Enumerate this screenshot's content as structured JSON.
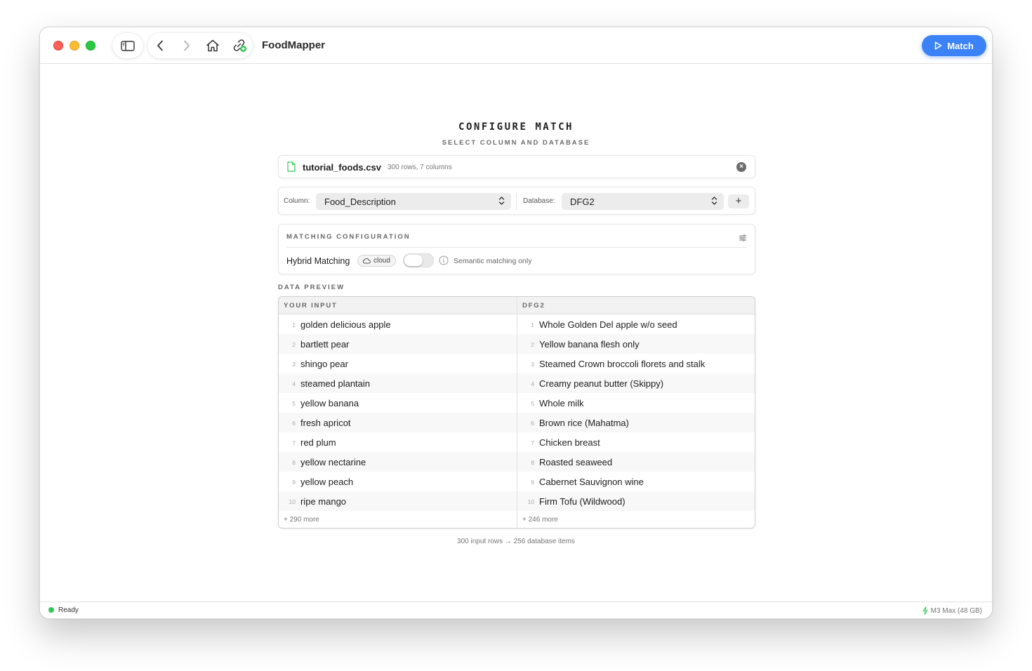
{
  "app": {
    "title": "FoodMapper"
  },
  "toolbar": {
    "match_label": "Match"
  },
  "heading": {
    "title": "CONFIGURE MATCH",
    "subtitle": "SELECT COLUMN AND DATABASE"
  },
  "file": {
    "name": "tutorial_foods.csv",
    "meta": "300 rows, 7 columns"
  },
  "selectors": {
    "column_label": "Column:",
    "column_value": "Food_Description",
    "database_label": "Database:",
    "database_value": "DFG2",
    "add_label": "+"
  },
  "config": {
    "title": "MATCHING CONFIGURATION",
    "hybrid_label": "Hybrid Matching",
    "cloud_badge": "cloud",
    "semantic_label": "Semantic matching only"
  },
  "preview": {
    "title": "DATA PREVIEW",
    "left": {
      "header": "YOUR INPUT",
      "rows": [
        {
          "n": "1",
          "text": "golden delicious apple"
        },
        {
          "n": "2",
          "text": "bartlett pear"
        },
        {
          "n": "3",
          "text": "shingo pear"
        },
        {
          "n": "4",
          "text": "steamed plantain"
        },
        {
          "n": "5",
          "text": "yellow banana"
        },
        {
          "n": "6",
          "text": "fresh apricot"
        },
        {
          "n": "7",
          "text": "red plum"
        },
        {
          "n": "8",
          "text": "yellow nectarine"
        },
        {
          "n": "9",
          "text": "yellow peach"
        },
        {
          "n": "10",
          "text": "ripe mango"
        }
      ],
      "more": "+ 290 more"
    },
    "right": {
      "header": "DFG2",
      "rows": [
        {
          "n": "1",
          "text": "Whole Golden Del apple w/o seed"
        },
        {
          "n": "2",
          "text": "Yellow banana flesh only"
        },
        {
          "n": "3",
          "text": "Steamed Crown broccoli florets and stalk"
        },
        {
          "n": "4",
          "text": "Creamy peanut butter (Skippy)"
        },
        {
          "n": "5",
          "text": "Whole milk"
        },
        {
          "n": "6",
          "text": "Brown rice (Mahatma)"
        },
        {
          "n": "7",
          "text": "Chicken breast"
        },
        {
          "n": "8",
          "text": "Roasted seaweed"
        },
        {
          "n": "9",
          "text": "Cabernet Sauvignon wine"
        },
        {
          "n": "10",
          "text": "Firm Tofu (Wildwood)"
        }
      ],
      "more": "+ 246 more"
    }
  },
  "summary": "300 input rows → 256 database items",
  "status": {
    "text": "Ready",
    "hardware": "M3 Max (48 GB)"
  },
  "colors": {
    "accent": "#3b82f6",
    "status_ok": "#34c759",
    "file_icon": "#34c759"
  }
}
